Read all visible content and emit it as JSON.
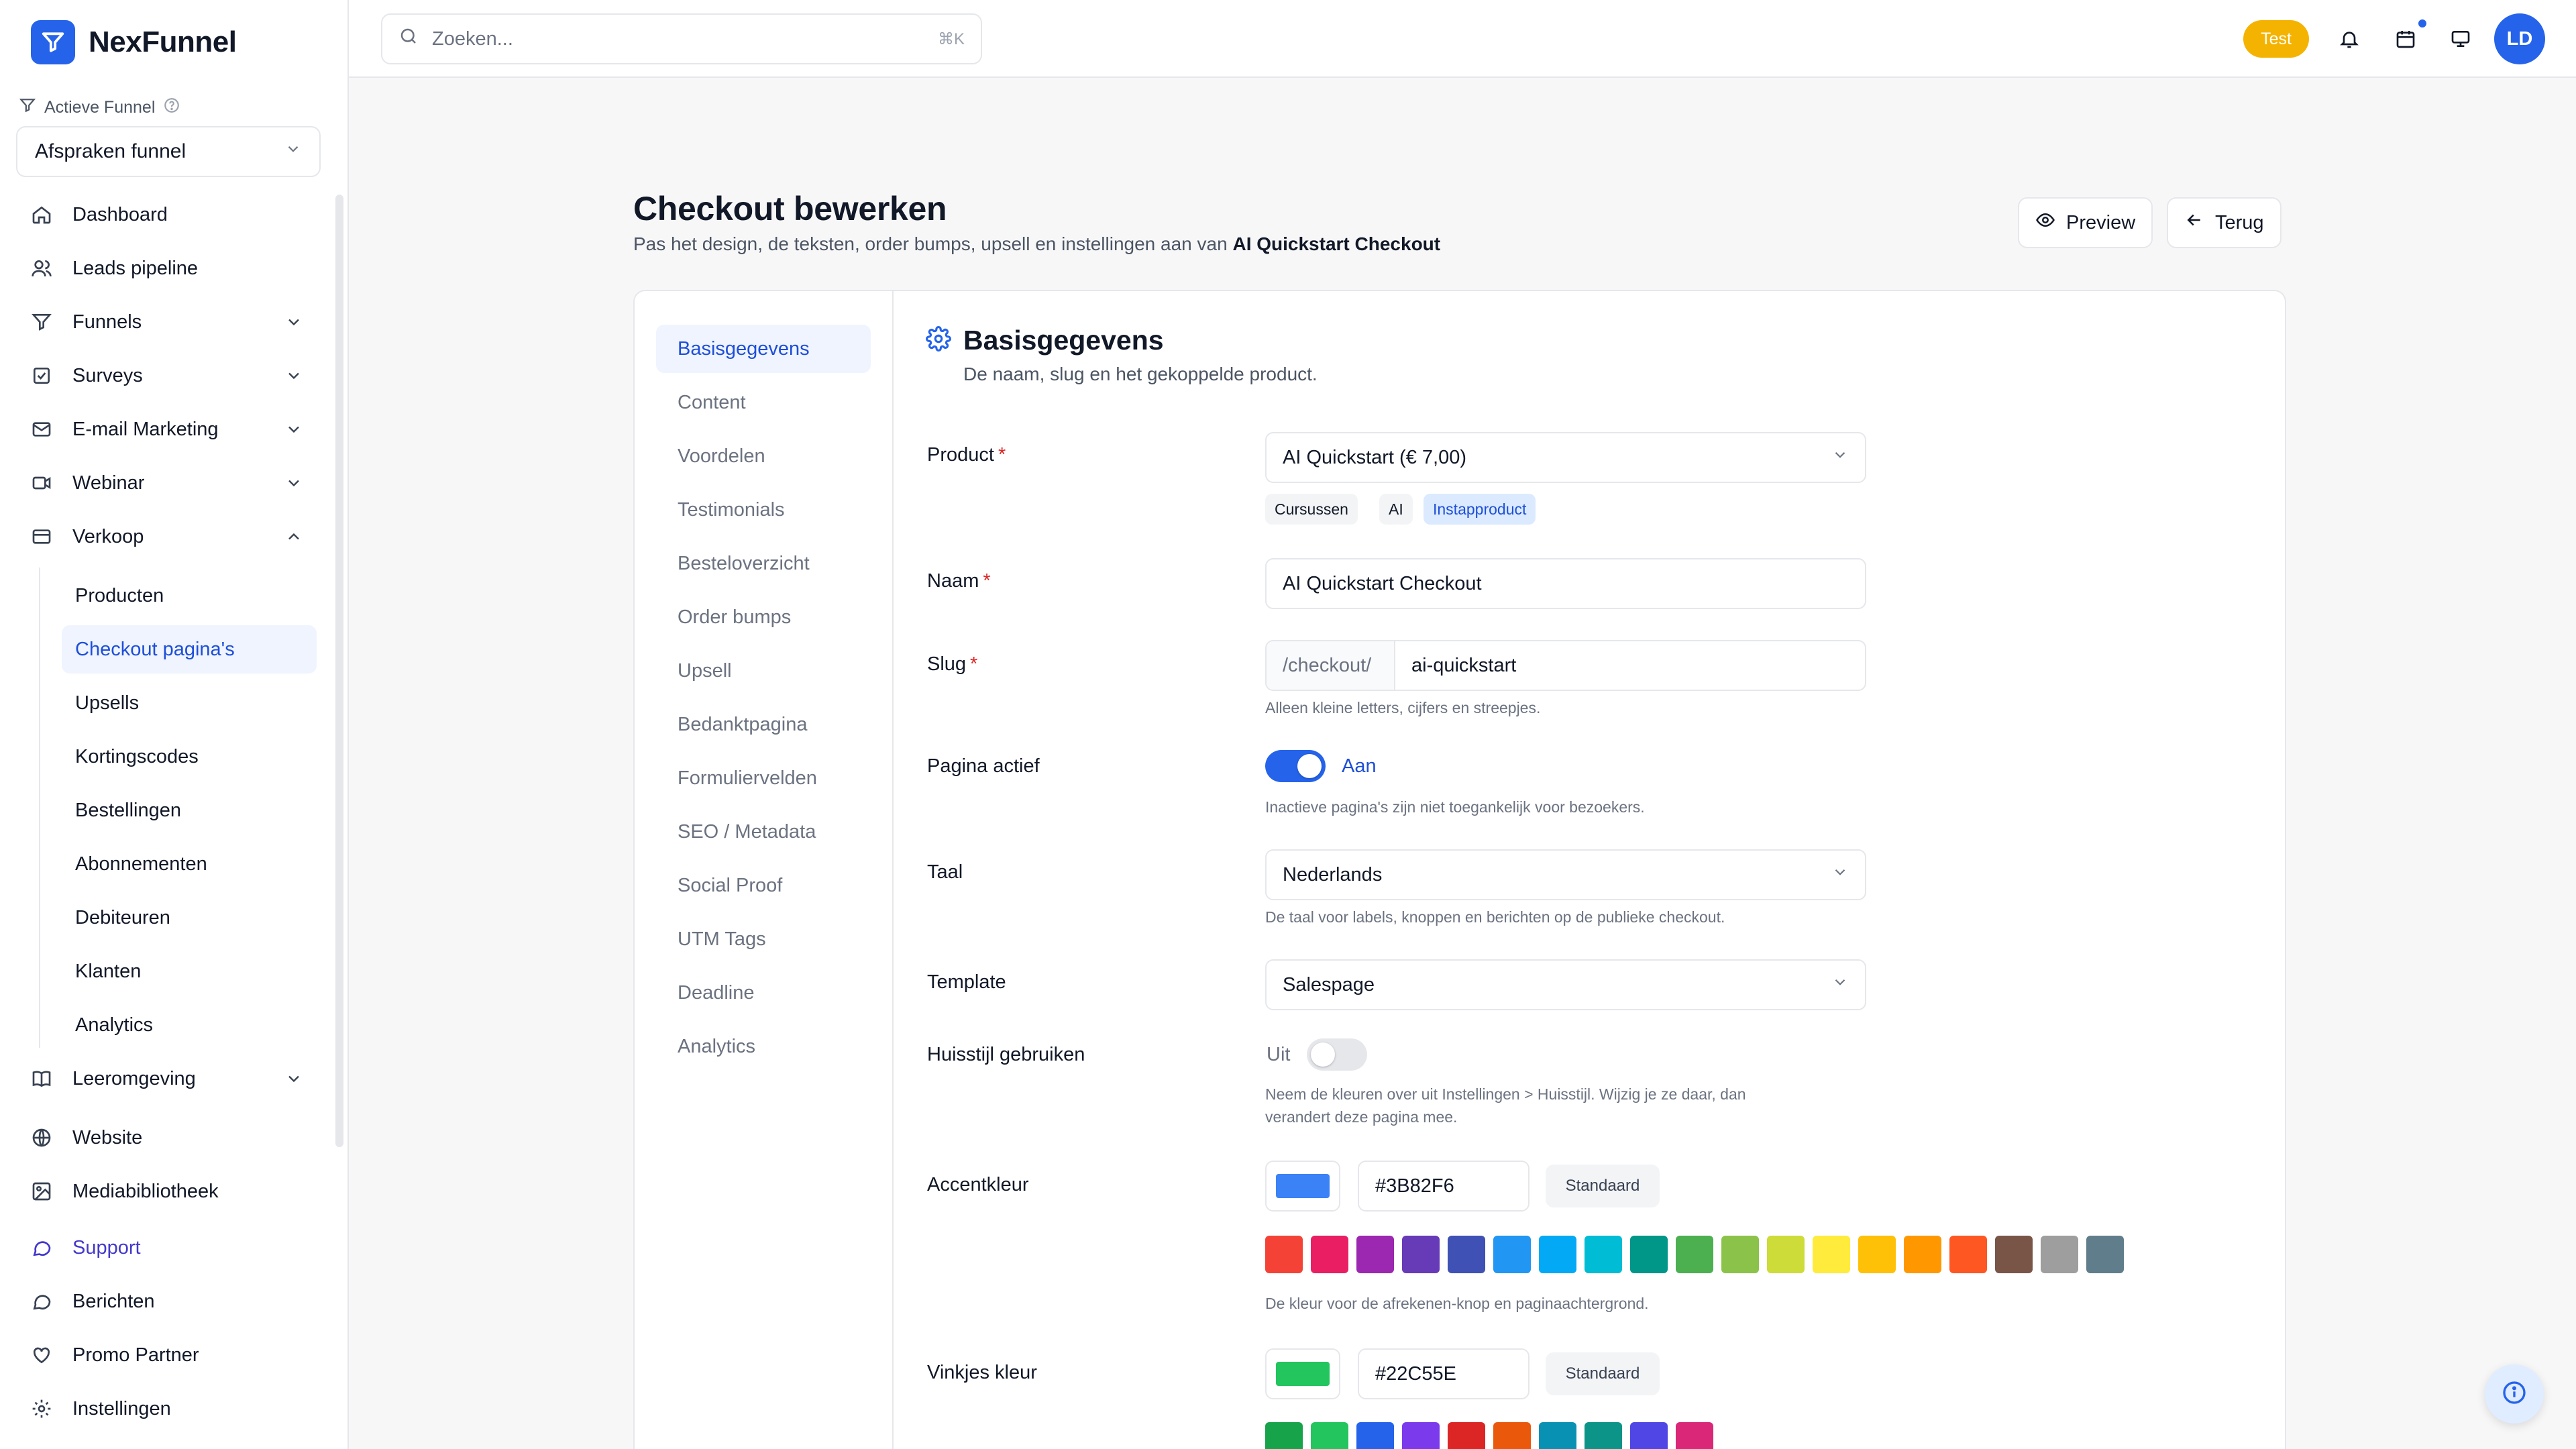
{
  "app": {
    "name": "NexFunnel"
  },
  "sidebar": {
    "funnel_label": "Actieve Funnel",
    "funnel_value": "Afspraken funnel",
    "items": [
      {
        "label": "Dashboard"
      },
      {
        "label": "Leads pipeline"
      },
      {
        "label": "Funnels"
      },
      {
        "label": "Surveys"
      },
      {
        "label": "E-mail Marketing"
      },
      {
        "label": "Webinar"
      },
      {
        "label": "Verkoop"
      },
      {
        "label": "Leeromgeving"
      },
      {
        "label": "Website"
      },
      {
        "label": "Mediabibliotheek"
      },
      {
        "label": "Support"
      },
      {
        "label": "Berichten"
      },
      {
        "label": "Promo Partner"
      },
      {
        "label": "Instellingen"
      }
    ],
    "sub_items": [
      {
        "label": "Producten"
      },
      {
        "label": "Checkout pagina's"
      },
      {
        "label": "Upsells"
      },
      {
        "label": "Kortingscodes"
      },
      {
        "label": "Bestellingen"
      },
      {
        "label": "Abonnementen"
      },
      {
        "label": "Debiteuren"
      },
      {
        "label": "Klanten"
      },
      {
        "label": "Analytics"
      }
    ]
  },
  "topbar": {
    "search_placeholder": "Zoeken...",
    "search_shortcut": "⌘K",
    "badge": "Test",
    "avatar_initials": "LD"
  },
  "page": {
    "title": "Checkout bewerken",
    "subtitle": "Pas het design, de teksten, order bumps, upsell en instellingen aan van ",
    "subtitle_bold": "AI Quickstart Checkout",
    "preview_label": "Preview",
    "back_label": "Terug"
  },
  "tabs": [
    {
      "label": "Basisgegevens"
    },
    {
      "label": "Content"
    },
    {
      "label": "Voordelen"
    },
    {
      "label": "Testimonials"
    },
    {
      "label": "Besteloverzicht"
    },
    {
      "label": "Order bumps"
    },
    {
      "label": "Upsell"
    },
    {
      "label": "Bedanktpagina"
    },
    {
      "label": "Formuliervelden"
    },
    {
      "label": "SEO / Metadata"
    },
    {
      "label": "Social Proof"
    },
    {
      "label": "UTM Tags"
    },
    {
      "label": "Deadline"
    },
    {
      "label": "Analytics"
    }
  ],
  "form": {
    "section_title": "Basisgegevens",
    "section_desc": "De naam, slug en het gekoppelde product.",
    "product": {
      "label": "Product",
      "value": "AI Quickstart (€ 7,00)",
      "chips": [
        "Cursussen",
        "AI",
        "Instapproduct"
      ]
    },
    "naam": {
      "label": "Naam",
      "value": "AI Quickstart Checkout"
    },
    "slug": {
      "label": "Slug",
      "prefix": "/checkout/",
      "value": "ai-quickstart",
      "hint": "Alleen kleine letters, cijfers en streepjes."
    },
    "pagina_actief": {
      "label": "Pagina actief",
      "state": "Aan",
      "hint": "Inactieve pagina's zijn niet toegankelijk voor bezoekers."
    },
    "taal": {
      "label": "Taal",
      "value": "Nederlands",
      "hint": "De taal voor labels, knoppen en berichten op de publieke checkout."
    },
    "template": {
      "label": "Template",
      "value": "Salespage"
    },
    "huisstijl": {
      "label": "Huisstijl gebruiken",
      "state": "Uit",
      "hint_line1": "Neem de kleuren over uit Instellingen > Huisstijl. Wijzig je ze daar, dan",
      "hint_line2": "verandert deze pagina mee."
    },
    "accentkleur": {
      "label": "Accentkleur",
      "value": "#3B82F6",
      "default_label": "Standaard",
      "hint": "De kleur voor de afrekenen-knop en paginaachtergrond."
    },
    "vinkjes": {
      "label": "Vinkjes kleur",
      "value": "#22C55E",
      "default_label": "Standaard"
    }
  },
  "colors": {
    "accent": "#3B82F6",
    "check": "#22C55E",
    "palette_accent": [
      "#f44336",
      "#e91e63",
      "#9c27b0",
      "#673ab7",
      "#3f51b5",
      "#2196f3",
      "#03a9f4",
      "#00bcd4",
      "#009688",
      "#4caf50",
      "#8bc34a",
      "#cddc39",
      "#ffeb3b",
      "#ffc107",
      "#ff9800",
      "#ff5722",
      "#795548",
      "#9e9e9e",
      "#607d8b"
    ],
    "palette_check": [
      "#16a34a",
      "#22c55e",
      "#2563eb",
      "#7c3aed",
      "#dc2626",
      "#ea580c",
      "#0891b2",
      "#0d9488",
      "#4f46e5",
      "#db2777"
    ]
  }
}
